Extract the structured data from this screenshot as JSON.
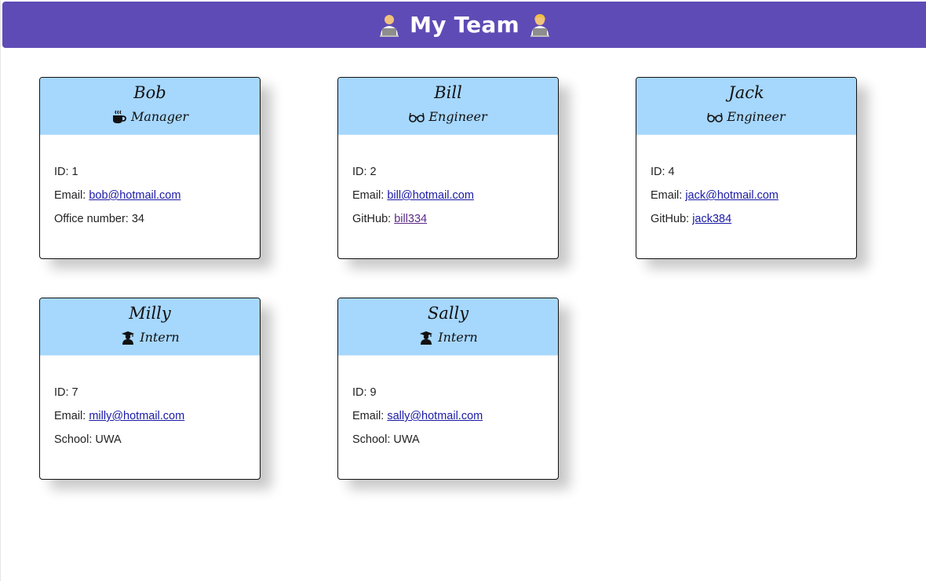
{
  "header": {
    "title": "My Team",
    "background": "#5f4bb6"
  },
  "cards": [
    {
      "name": "Bob",
      "role": "Manager",
      "role_icon": "coffee-icon",
      "id_label": "ID: 1",
      "email_label": "Email: ",
      "email": "bob@hotmail.com",
      "extra_label": "Office number: 34",
      "extra_link": ""
    },
    {
      "name": "Bill",
      "role": "Engineer",
      "role_icon": "glasses-icon",
      "id_label": "ID: 2",
      "email_label": "Email: ",
      "email": "bill@hotmail.com",
      "extra_label": "GitHub: ",
      "extra_link": "bill334"
    },
    {
      "name": "Jack",
      "role": "Engineer",
      "role_icon": "glasses-icon",
      "id_label": "ID: 4",
      "email_label": "Email: ",
      "email": "jack@hotmail.com",
      "extra_label": "GitHub: ",
      "extra_link": "jack384"
    },
    {
      "name": "Milly",
      "role": "Intern",
      "role_icon": "graduate-icon",
      "id_label": "ID: 7",
      "email_label": "Email: ",
      "email": "milly@hotmail.com",
      "extra_label": "School: UWA",
      "extra_link": ""
    },
    {
      "name": "Sally",
      "role": "Intern",
      "role_icon": "graduate-icon",
      "id_label": "ID: 9",
      "email_label": "Email: ",
      "email": "sally@hotmail.com",
      "extra_label": "School: UWA",
      "extra_link": ""
    }
  ],
  "colors": {
    "card_header": "#a6d7fd",
    "link": "#1a1aa6",
    "visited_link": "#5b2a86"
  }
}
